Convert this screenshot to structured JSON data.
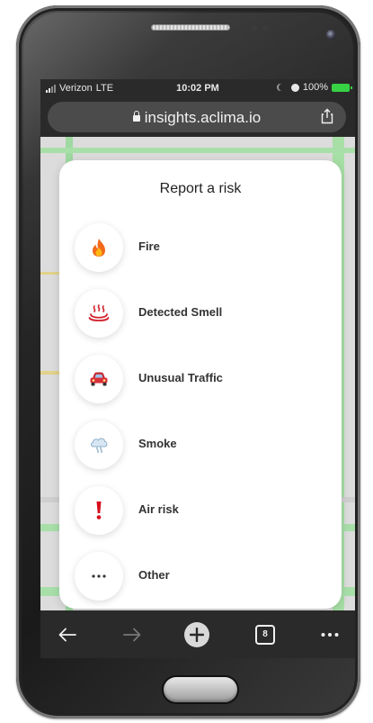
{
  "status_bar": {
    "carrier": "Verizon",
    "network": "LTE",
    "time": "10:02 PM",
    "battery_percent": "100%",
    "battery_color": "#36d243"
  },
  "browser": {
    "url": "insights.aclima.io",
    "share_icon": "share-icon",
    "lock_icon": "lock-icon"
  },
  "modal": {
    "title": "Report a risk",
    "items": [
      {
        "label": "Fire",
        "icon": "fire-icon"
      },
      {
        "label": "Detected Smell",
        "icon": "smell-icon"
      },
      {
        "label": "Unusual Traffic",
        "icon": "car-icon"
      },
      {
        "label": "Smoke",
        "icon": "smoke-icon"
      },
      {
        "label": "Air risk",
        "icon": "exclamation-icon"
      },
      {
        "label": "Other",
        "icon": "more-icon"
      }
    ]
  },
  "toolbar": {
    "tab_count": "8",
    "icons": [
      "back-arrow-icon",
      "forward-arrow-icon",
      "new-tab-plus-icon",
      "tabs-icon",
      "more-icon"
    ]
  }
}
